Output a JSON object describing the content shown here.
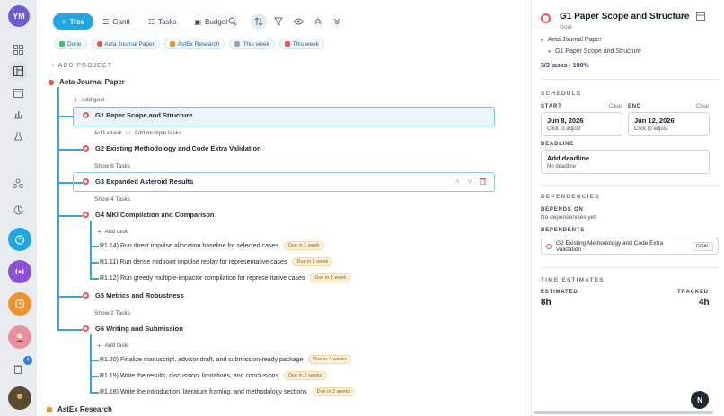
{
  "rail": {
    "avatar_initials": "YM",
    "notification_count": "4"
  },
  "toolbar": {
    "tabs": [
      "Tree",
      "Gantt",
      "Tasks",
      "Budget"
    ],
    "active_tab": "Tree"
  },
  "filters": [
    "Done",
    "Acta Journal Paper",
    "AstEx Research",
    "This week",
    "This week"
  ],
  "add_project_label": "+ ADD PROJECT",
  "tree": {
    "project": "Acta Journal Paper",
    "add_goal": "Add goal",
    "goals": [
      {
        "title": "G1 Paper Scope and Structure",
        "add_task": "Add a task",
        "or": "or",
        "add_multiple": "Add multiple tasks"
      },
      {
        "title": "G2 Existing Methodology and Code Extra Validation",
        "show": "Show 6 Tasks"
      },
      {
        "title": "G3 Expanded Asteroid Results",
        "show": "Show 4 Tasks"
      },
      {
        "title": "G4 MKI Compilation and Comparison",
        "add_task": "Add task",
        "tasks": [
          {
            "title": "R1.14) Run direct impulse allocation baseline for selected cases",
            "due": "Due in 1 week"
          },
          {
            "title": "R1.11) Run dense midpoint impulse replay for representative cases",
            "due": "Due in 1 week"
          },
          {
            "title": "R1.12) Run greedy multiple-impactor compilation for representative cases",
            "due": "Due in 1 week"
          }
        ]
      },
      {
        "title": "G5 Metrics and Robustness",
        "show": "Show 2 Tasks"
      },
      {
        "title": "G6 Writing and Submission",
        "add_task": "Add task",
        "tasks": [
          {
            "title": "R1.20) Finalize manuscript, advisor draft, and submission-ready package",
            "due": "Due in 3 weeks"
          },
          {
            "title": "R1.19) Write the results, discussion, limitations, and conclusions",
            "due": "Due in 2 weeks"
          },
          {
            "title": "R1.18) Write the introduction, literature framing, and methodology sections",
            "due": "Due in 2 weeks"
          }
        ]
      }
    ],
    "next_project": "AstEx Research"
  },
  "panel": {
    "title": "G1 Paper Scope and Structure",
    "type": "Goal",
    "crumbs": [
      "Acta Journal Paper",
      "G1 Paper Scope and Structure"
    ],
    "progress": "3/3 tasks - 100%",
    "schedule_label": "SCHEDULE",
    "start_label": "START",
    "end_label": "END",
    "clear_label": "Clear",
    "start_date": "Jun 8, 2026",
    "end_date": "Jun 12, 2026",
    "adjust_hint": "Click to adjust",
    "deadline_label": "DEADLINE",
    "deadline_value": "Add deadline",
    "deadline_hint": "No deadline",
    "dependencies_label": "DEPENDENCIES",
    "depends_on_label": "DEPENDS ON",
    "depends_on_value": "No dependencies yet.",
    "dependents_label": "DEPENDENTS",
    "dependent_item": "G2 Existing Methodology and Code Extra Validation",
    "dependent_badge": "GOAL",
    "time_label": "TIME ESTIMATES",
    "estimated_label": "ESTIMATED",
    "tracked_label": "TRACKED",
    "estimated_value": "8h",
    "tracked_value": "4h"
  },
  "fab_label": "N",
  "colors": {
    "accent": "#1ea7e8",
    "tree_line": "#3aa6d6",
    "goal_icon": "#e45a5a",
    "due_bg": "#fff2d9"
  }
}
